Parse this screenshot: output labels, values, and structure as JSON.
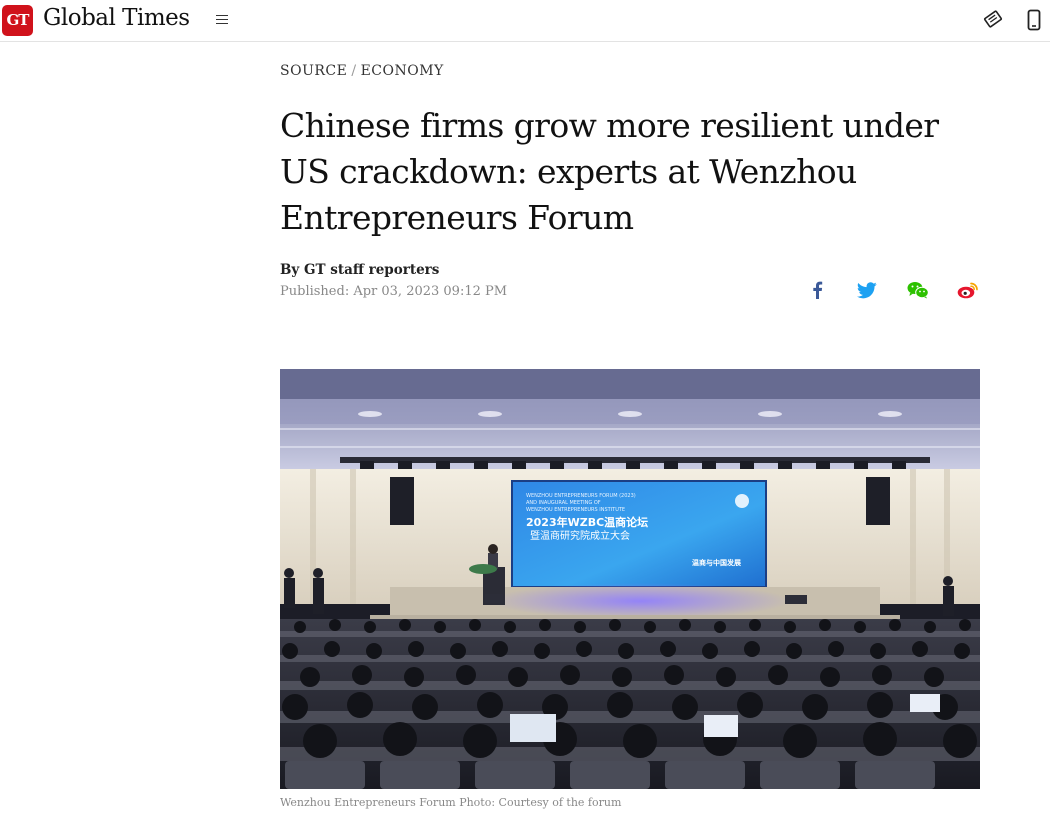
{
  "header": {
    "logo_badge": "GT",
    "logo_text": "Global Times",
    "menu_icon": "hamburger-menu-icon",
    "right_icons": [
      "newspaper-icon",
      "mobile-phone-icon"
    ]
  },
  "article": {
    "breadcrumb": {
      "section": "SOURCE",
      "separator": "/",
      "subsection": "ECONOMY"
    },
    "title": "Chinese firms grow more resilient under US crackdown: experts at Wenzhou Entrepreneurs Forum",
    "byline": "By GT staff reporters",
    "published": "Published: Apr 03, 2023 09:12 PM",
    "share_icons": [
      "facebook-icon",
      "twitter-icon",
      "wechat-icon",
      "weibo-icon"
    ]
  },
  "photo": {
    "screen_line1": "WENZHOU ENTREPRENEURS FORUM (2023)",
    "screen_line2": "AND INAUGURAL MEETING OF",
    "screen_line3": "WENZHOU ENTREPRENEURS INSTITUTE",
    "screen_title1": "2023年WZBC温商论坛",
    "screen_title2": "暨温商研究院成立大会",
    "screen_badge": "温商与中国发展",
    "caption": "Wenzhou Entrepreneurs Forum Photo: Courtesy of the forum"
  },
  "colors": {
    "brand_red": "#d0121b",
    "facebook": "#3b5998",
    "twitter": "#1da1f2",
    "wechat": "#2dc100",
    "weibo": "#e6162d"
  }
}
